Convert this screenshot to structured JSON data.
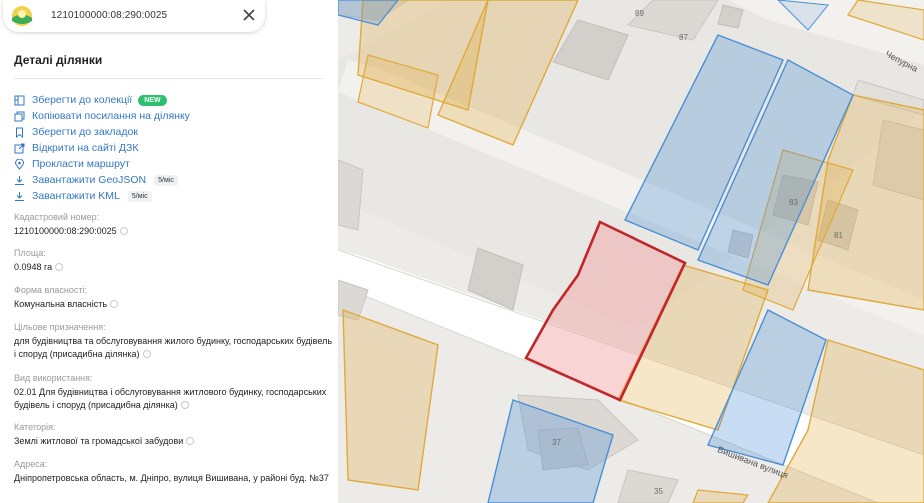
{
  "search": {
    "query": "1210100000:08:290:0025"
  },
  "panel": {
    "title": "Деталі ділянки",
    "actions": [
      {
        "label": "Зберегти до колекції",
        "icon": "collection-icon",
        "badge": "NEW"
      },
      {
        "label": "Копіювати посилання на ділянку",
        "icon": "copy-icon"
      },
      {
        "label": "Зберегти до закладок",
        "icon": "bookmark-icon"
      },
      {
        "label": "Відкрити на сайті ДЗК",
        "icon": "external-link-icon"
      },
      {
        "label": "Прокласти маршрут",
        "icon": "location-pin-icon"
      },
      {
        "label": "Завантажити GeoJSON",
        "icon": "download-icon",
        "limit": "5/міс"
      },
      {
        "label": "Завантажити KML",
        "icon": "download-icon",
        "limit": "5/міс"
      }
    ],
    "fields": [
      {
        "label": "Кадастровий номер:",
        "value": "1210100000:08:290:0025"
      },
      {
        "label": "Площа:",
        "value": "0.0948 га"
      },
      {
        "label": "Форма власності:",
        "value": "Комунальна власність"
      },
      {
        "label": "Цільове призначення:",
        "value": "для будівництва та обслуговування жилого будинку, господарських будівель і споруд (присадибна ділянка)"
      },
      {
        "label": "Вид використання:",
        "value": "02.01 Для будівництва і обслуговування житлового будинку, господарських будівель і споруд (присадибна ділянка)"
      },
      {
        "label": "Категорія:",
        "value": "Землі житлової та громадської забудови"
      },
      {
        "label": "Адреса:",
        "value": "Дніпропетровська область, м. Дніпро, вулиця Вишивана, у районі буд. №37"
      }
    ]
  },
  "map": {
    "house_numbers": [
      "89",
      "87",
      "83",
      "81",
      "37",
      "35"
    ],
    "streets": [
      "Чепурна",
      "Вишивана вулиця"
    ],
    "colors": {
      "selected_parcel": "#c0262a",
      "selected_fill": "#f6c9c9",
      "orange_parcel": "#e0a93a",
      "blue_parcel": "#4a8fd6",
      "building": "#d6d2cd",
      "road": "#ffffff"
    }
  }
}
